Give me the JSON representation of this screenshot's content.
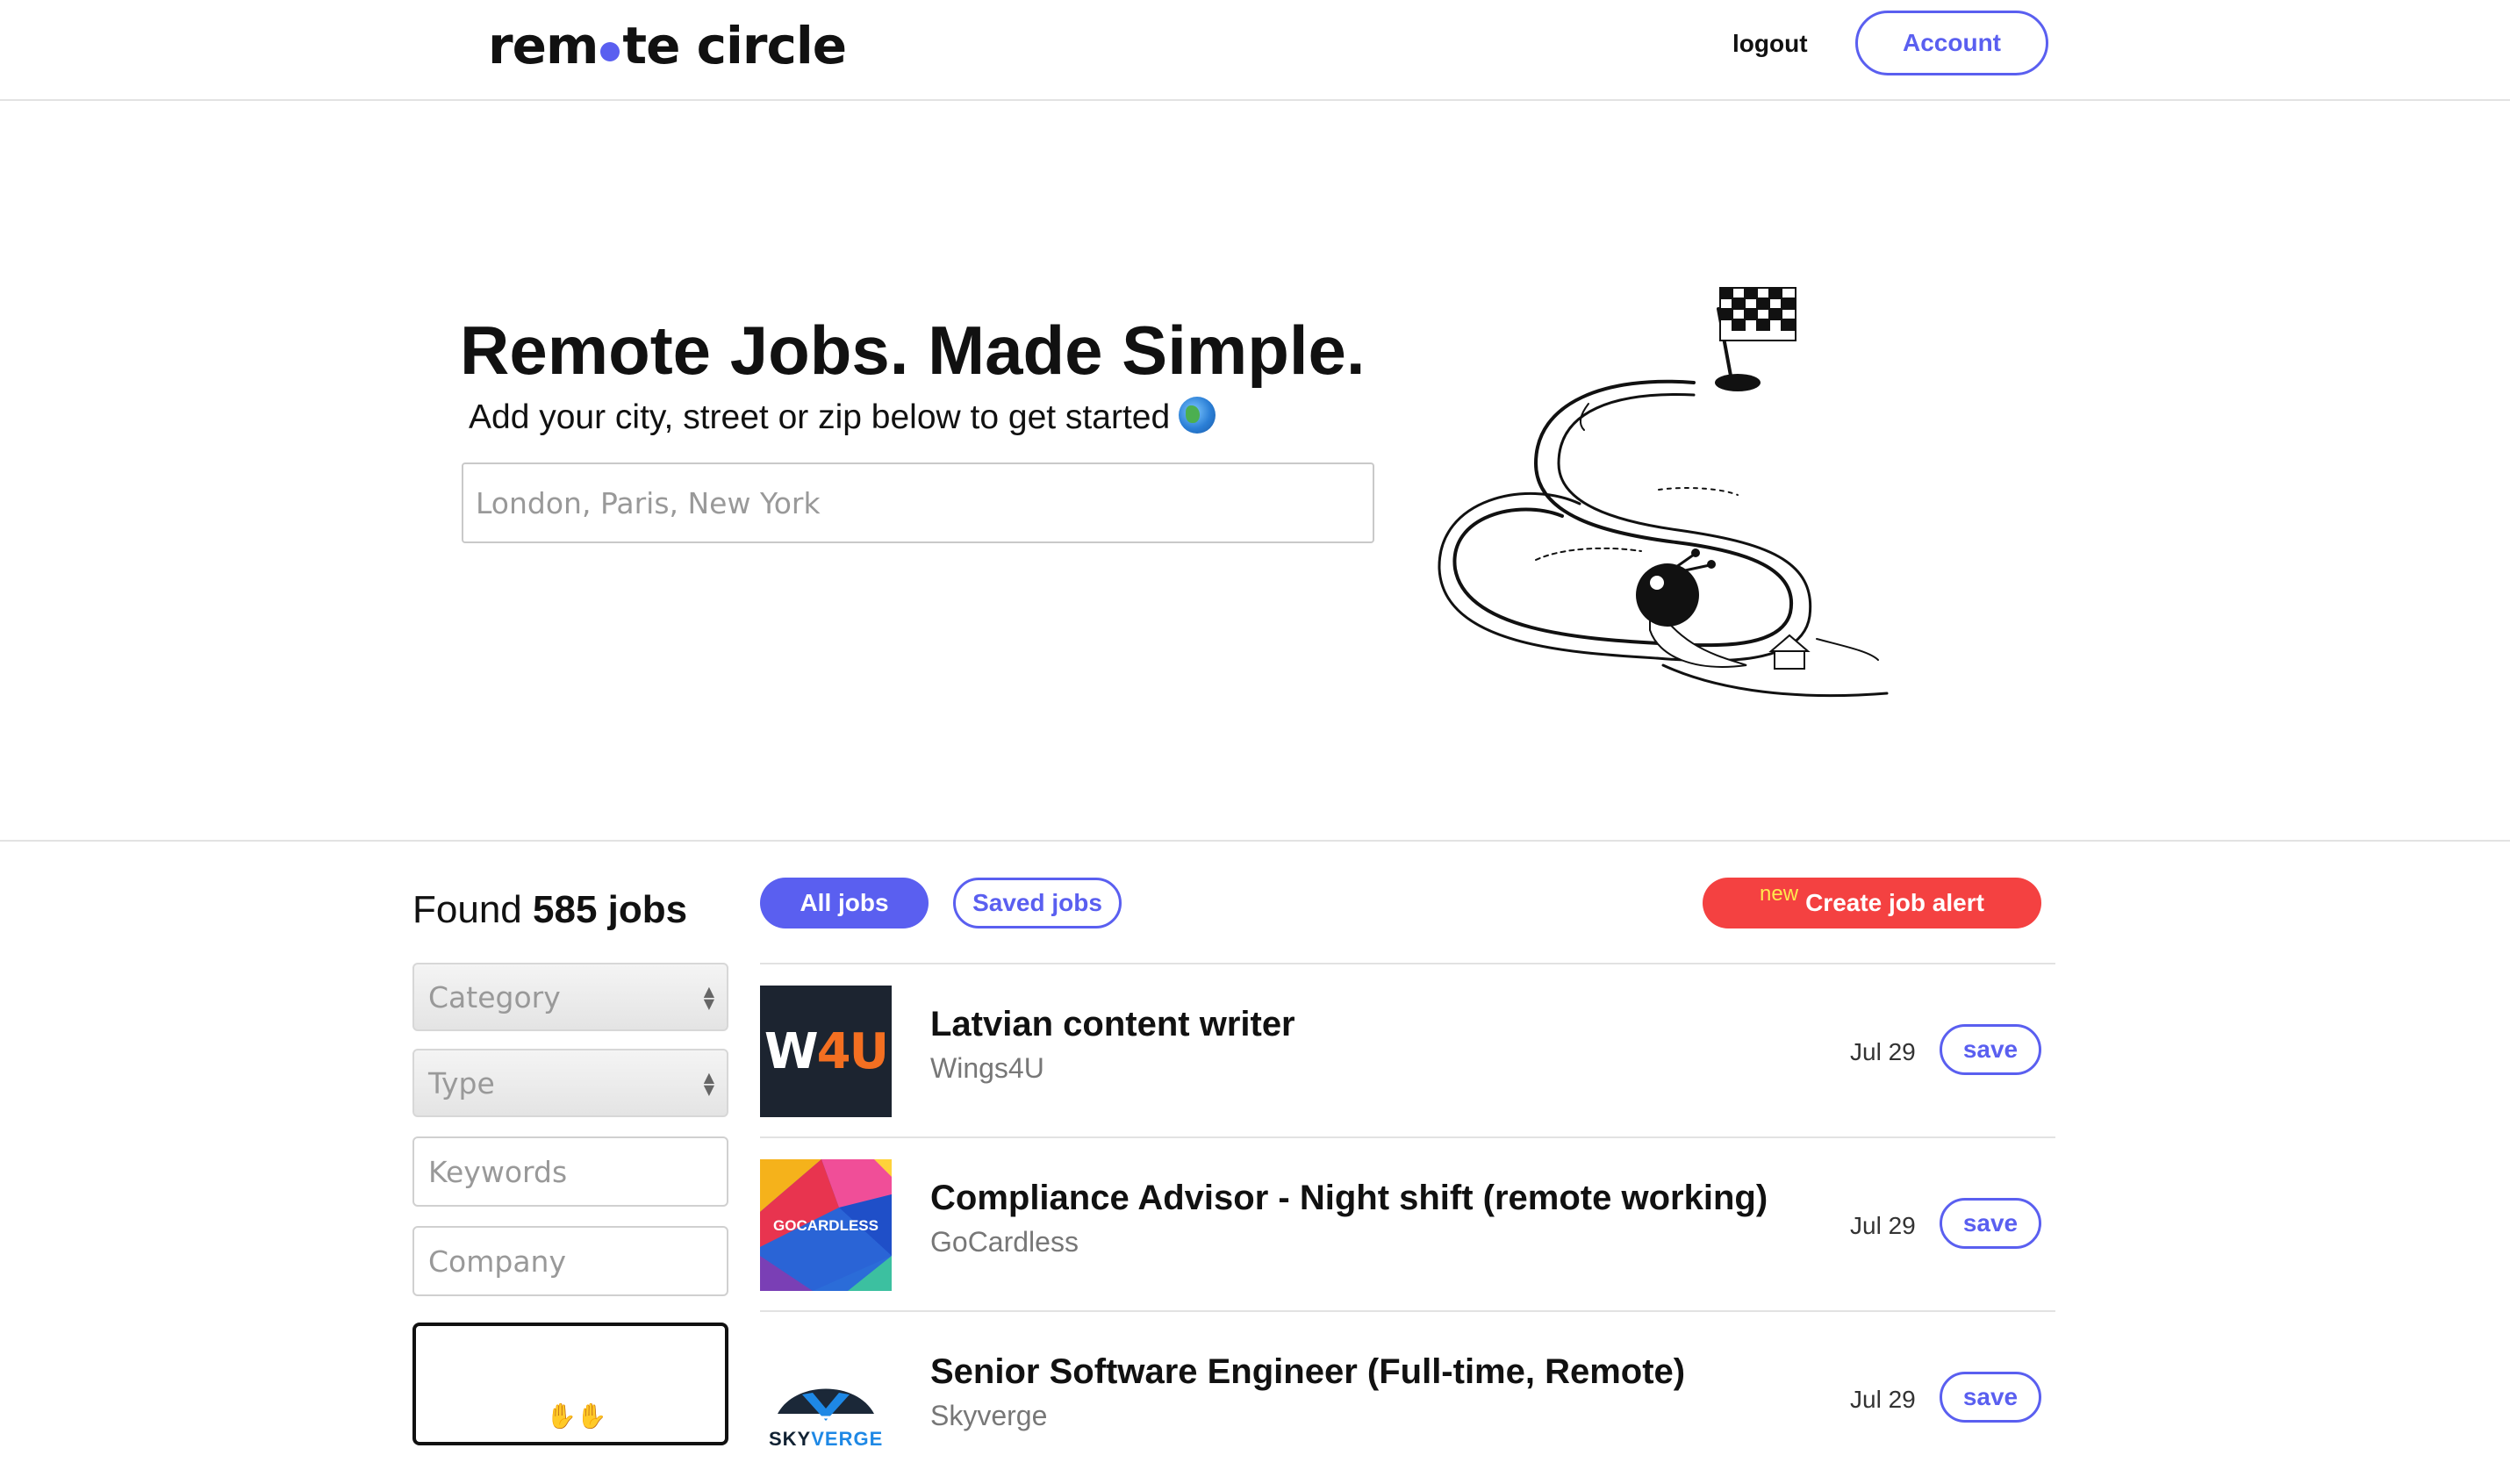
{
  "header": {
    "logo_before": "rem",
    "logo_after": "te circle",
    "logout_label": "logout",
    "account_label": "Account"
  },
  "hero": {
    "title": "Remote Jobs. Made Simple.",
    "subtitle": "Add your city, street or zip below to get started",
    "location_placeholder": "London, Paris, New York"
  },
  "sidebar": {
    "found_prefix": "Found",
    "found_count": "585 jobs",
    "category_placeholder": "Category",
    "type_placeholder": "Type",
    "keywords_placeholder": "Keywords",
    "company_placeholder": "Company"
  },
  "filters": {
    "all_jobs": "All jobs",
    "saved_jobs": "Saved jobs",
    "alert_new": "new",
    "create_alert": "Create job alert"
  },
  "jobs": [
    {
      "title": "Latvian content writer",
      "company": "Wings4U",
      "date": "Jul 29",
      "save": "save",
      "logo_text_a": "W",
      "logo_text_b": "4U"
    },
    {
      "title": "Compliance Advisor - Night shift (remote working)",
      "company": "GoCardless",
      "date": "Jul 29",
      "save": "save",
      "logo_text": "GOCARDLESS"
    },
    {
      "title": "Senior Software Engineer (Full-time, Remote)",
      "company": "Skyverge",
      "date": "Jul 29",
      "save": "save",
      "logo_text_a": "SKY",
      "logo_text_b": "VERGE"
    }
  ],
  "colors": {
    "accent": "#5a5ff0",
    "alert": "#f44141",
    "alert_new_tag": "#ffe94d"
  }
}
